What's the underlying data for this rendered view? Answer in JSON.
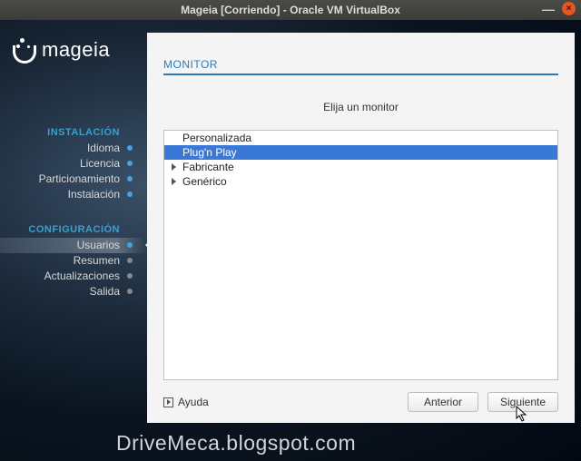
{
  "title": "Mageia [Corriendo] - Oracle VM VirtualBox",
  "logo_text": "mageia",
  "sidebar": {
    "section1": "INSTALACIÓN",
    "items1": [
      {
        "label": "Idioma",
        "done": true
      },
      {
        "label": "Licencia",
        "done": true
      },
      {
        "label": "Particionamiento",
        "done": true
      },
      {
        "label": "Instalación",
        "done": true
      }
    ],
    "section2": "CONFIGURACIÓN",
    "items2": [
      {
        "label": "Usuarios",
        "done": true,
        "active": true
      },
      {
        "label": "Resumen",
        "done": false
      },
      {
        "label": "Actualizaciones",
        "done": false
      },
      {
        "label": "Salida",
        "done": false
      }
    ]
  },
  "panel": {
    "heading": "MONITOR",
    "prompt": "Elija un monitor",
    "options": [
      {
        "label": "Personalizada",
        "expandable": false,
        "selected": false
      },
      {
        "label": "Plug'n Play",
        "expandable": false,
        "selected": true
      },
      {
        "label": "Fabricante",
        "expandable": true,
        "selected": false
      },
      {
        "label": "Genérico",
        "expandable": true,
        "selected": false
      }
    ]
  },
  "footer": {
    "help": "Ayuda",
    "prev": "Anterior",
    "next": "Siguiente"
  },
  "watermark": "DriveMeca.blogspot.com"
}
